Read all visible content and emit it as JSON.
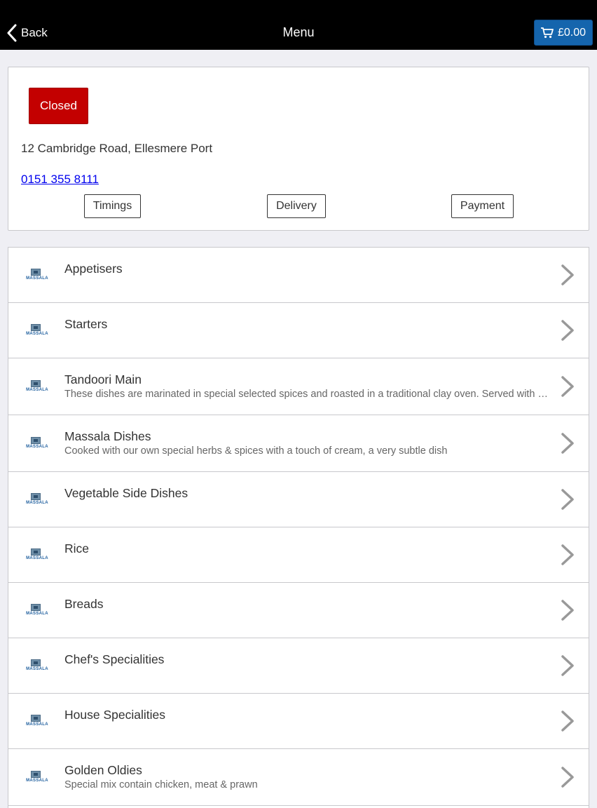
{
  "nav": {
    "back_label": "Back",
    "title": "Menu",
    "cart_amount": "£0.00",
    "cart_color": "#1565ad"
  },
  "restaurant": {
    "status": "Closed",
    "status_color": "#c30000",
    "address": "12 Cambridge Road,  Ellesmere Port",
    "phone": "0151 355 8111",
    "buttons": {
      "timings": "Timings",
      "delivery": "Delivery",
      "payment": "Payment"
    }
  },
  "logo_text": "MASSALA",
  "categories": [
    {
      "title": "Appetisers",
      "description": ""
    },
    {
      "title": "Starters",
      "description": ""
    },
    {
      "title": "Tandoori Main",
      "description": "These dishes are marinated in special selected spices and roasted in a traditional clay oven. Served with salad and mint sauce"
    },
    {
      "title": "Massala Dishes",
      "description": "Cooked with our own special herbs & spices with a touch of cream, a very subtle dish"
    },
    {
      "title": "Vegetable Side Dishes",
      "description": ""
    },
    {
      "title": "Rice",
      "description": ""
    },
    {
      "title": "Breads",
      "description": ""
    },
    {
      "title": "Chef's Specialities",
      "description": ""
    },
    {
      "title": "House Specialities",
      "description": ""
    },
    {
      "title": "Golden Oldies",
      "description": "Special mix contain chicken, meat & prawn"
    }
  ],
  "icons": {
    "back": "chevron-left-icon",
    "cart": "cart-icon",
    "row": "chevron-right-icon",
    "logo": "massala-logo"
  }
}
